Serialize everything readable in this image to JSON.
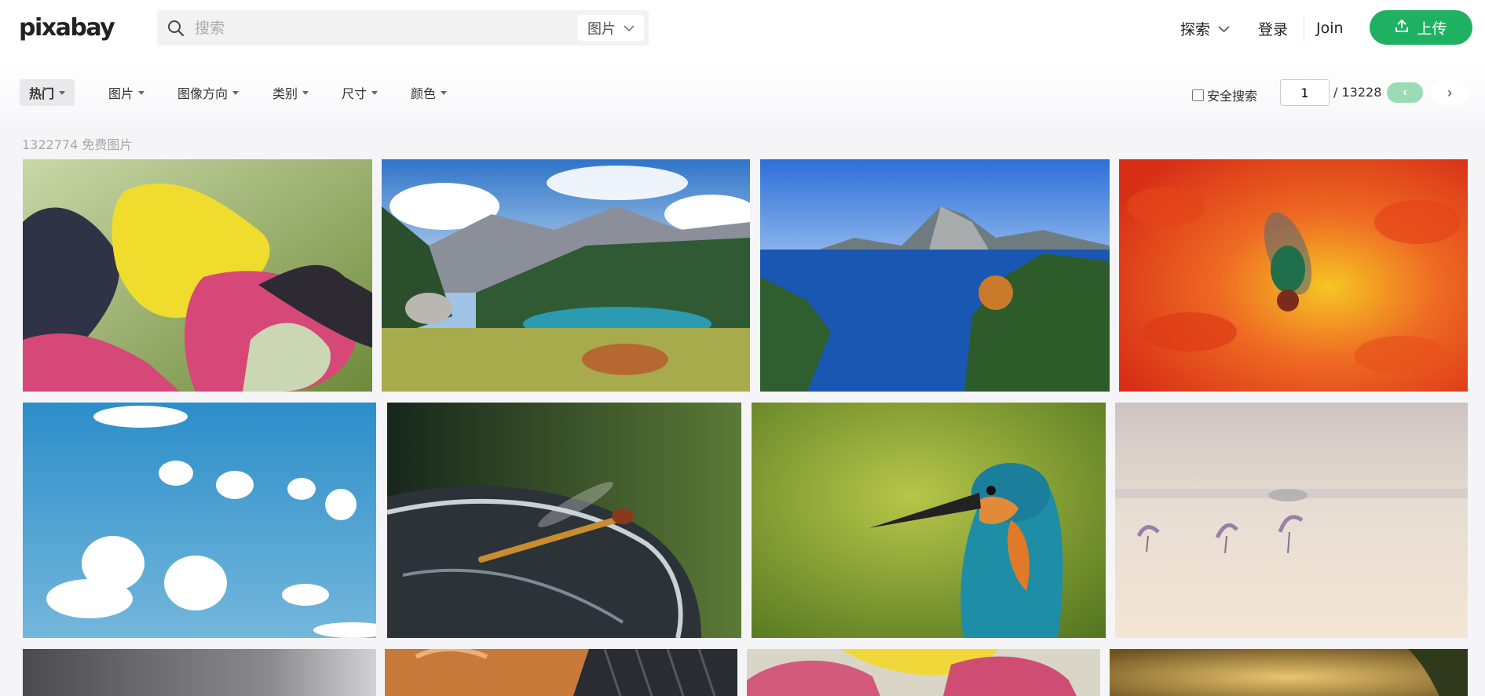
{
  "header": {
    "logo": "pixabay",
    "search": {
      "placeholder": "搜索",
      "type_label": "图片"
    },
    "nav": {
      "explore": "探索",
      "login": "登录",
      "join": "Join",
      "upload": "上传"
    }
  },
  "filters": {
    "items": [
      {
        "label": "热门"
      },
      {
        "label": "图片"
      },
      {
        "label": "图像方向"
      },
      {
        "label": "类别"
      },
      {
        "label": "尺寸"
      },
      {
        "label": "颜色"
      }
    ],
    "safe_search": "安全搜索",
    "pagination": {
      "current_page": "1",
      "total": "/ 13228",
      "prev": "‹",
      "next": "›"
    }
  },
  "results": {
    "count_text": "1322774 免费图片"
  },
  "colors": {
    "brand_green": "#1eb161",
    "prev_disabled": "#9bdcb6"
  },
  "photos": [
    {
      "subject": "colorful farfalle pasta"
    },
    {
      "subject": "highland cow by mountain lake"
    },
    {
      "subject": "alpine lake with mountain peak"
    },
    {
      "subject": "green fly on orange flower"
    },
    {
      "subject": "white clouds in blue sky"
    },
    {
      "subject": "dragonfly on chrome surface"
    },
    {
      "subject": "kingfisher bird"
    },
    {
      "subject": "flamingos walking in water"
    },
    {
      "subject": "blurry grey photo"
    },
    {
      "subject": "cat near wicker"
    },
    {
      "subject": "pink and yellow pasta"
    },
    {
      "subject": "golden sunset landscape"
    }
  ]
}
